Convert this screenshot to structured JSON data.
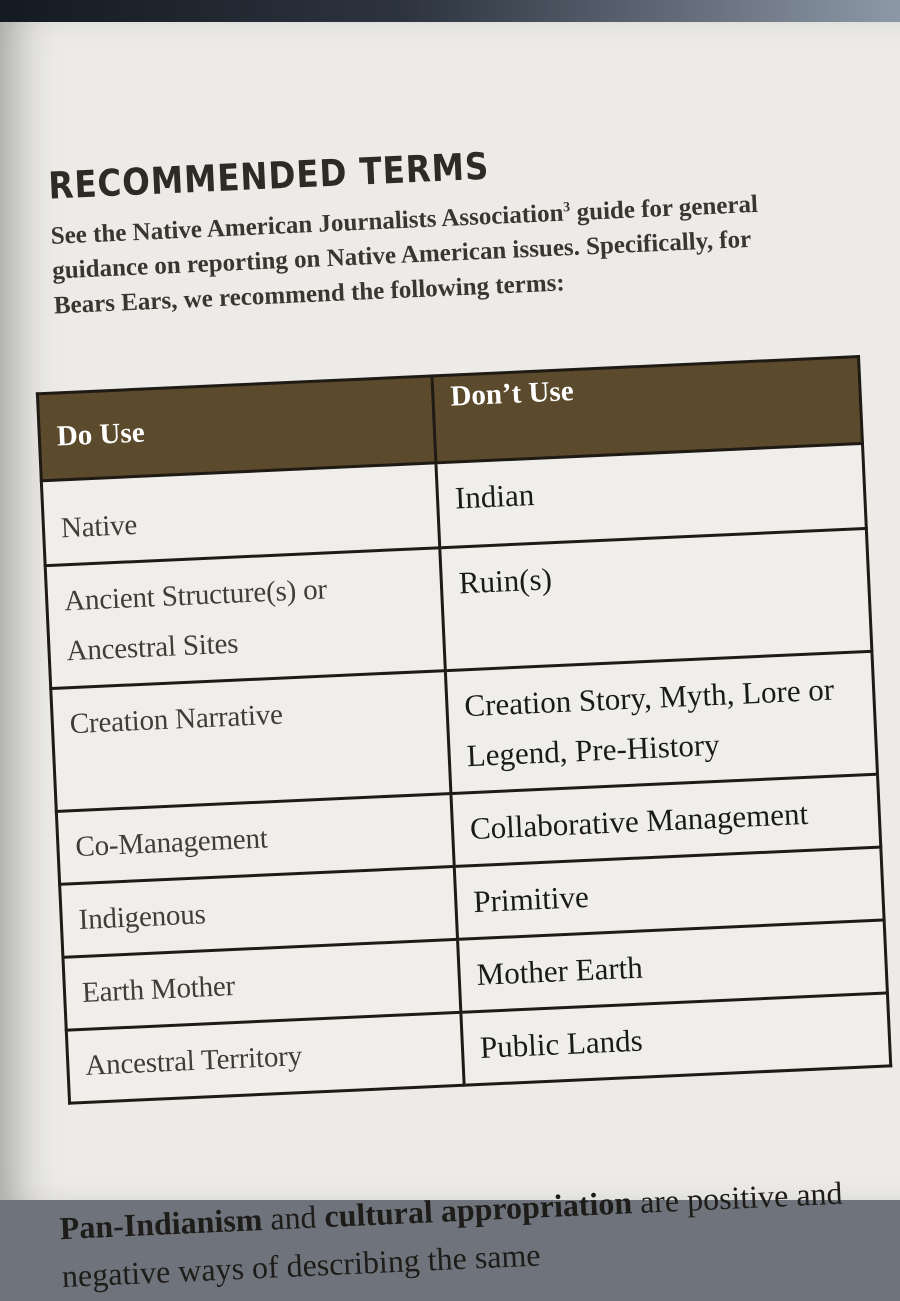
{
  "page": {
    "heading": "RECOMMENDED TERMS",
    "intro_before_superscript": "See the Native American Journalists Association",
    "intro_superscript": "3",
    "intro_after_superscript": " guide for general guidance on reporting on Native American issues. Specifically, for Bears Ears, we recommend the following terms:"
  },
  "table": {
    "headers": {
      "do_use": "Do Use",
      "dont_use": "Don’t Use"
    },
    "rows": [
      {
        "do": "Native",
        "dont": "Indian"
      },
      {
        "do": "Ancient Structure(s) or Ancestral Sites",
        "dont": "Ruin(s)"
      },
      {
        "do": "Creation Narrative",
        "dont": "Creation Story, Myth, Lore or Legend, Pre-History"
      },
      {
        "do": "Co-Management",
        "dont": "Collaborative Management"
      },
      {
        "do": "Indigenous",
        "dont": "Primitive"
      },
      {
        "do": "Earth Mother",
        "dont": "Mother Earth"
      },
      {
        "do": "Ancestral Territory",
        "dont": "Public Lands"
      }
    ]
  },
  "bottom": {
    "term1": "Pan-Indianism",
    "joiner": " and ",
    "term2": "cultural appropriation",
    "rest": " are positive and negative ways of describing the same"
  },
  "colors": {
    "header_bg": "#5b4a2c",
    "paper": "#ecebe8",
    "rule": "#1f1a14"
  }
}
